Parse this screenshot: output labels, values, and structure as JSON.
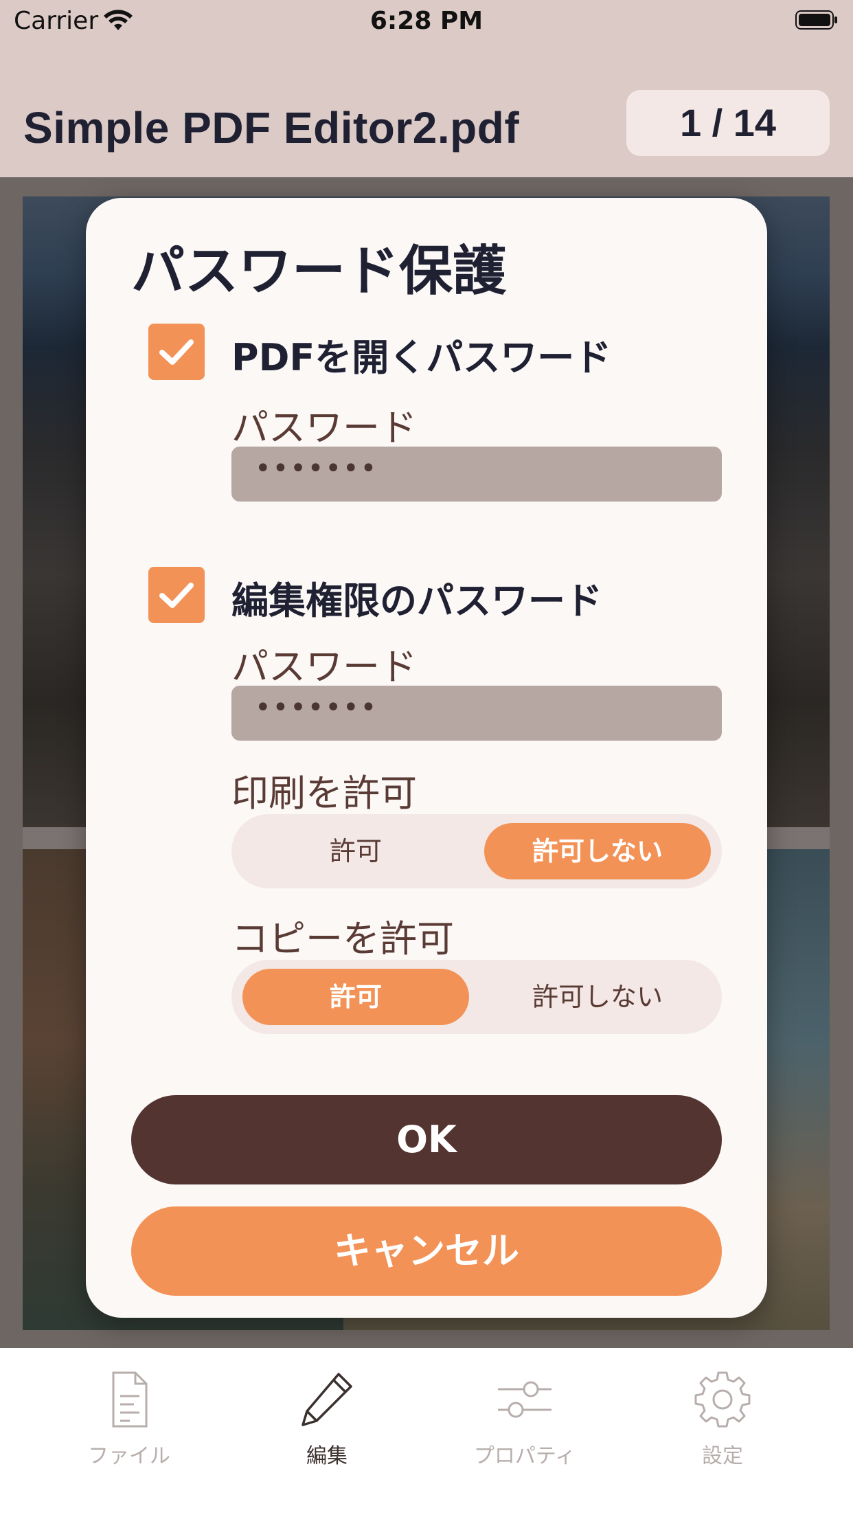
{
  "status_bar": {
    "carrier": "Carrier",
    "time": "6:28 PM"
  },
  "header": {
    "title": "Simple PDF Editor2.pdf",
    "page_counter": "1 / 14"
  },
  "dialog": {
    "title": "パスワード保護",
    "open_password": {
      "checked": true,
      "label": "PDFを開くパスワード",
      "field_label": "パスワード",
      "value": "•••••••"
    },
    "edit_password": {
      "checked": true,
      "label": "編集権限のパスワード",
      "field_label": "パスワード",
      "value": "•••••••"
    },
    "print_permission": {
      "label": "印刷を許可",
      "options": [
        "許可",
        "許可しない"
      ],
      "selected": "許可しない"
    },
    "copy_permission": {
      "label": "コピーを許可",
      "options": [
        "許可",
        "許可しない"
      ],
      "selected": "許可"
    },
    "ok_label": "OK",
    "cancel_label": "キャンセル"
  },
  "tab_bar": {
    "items": [
      {
        "label": "ファイル",
        "icon": "document-icon",
        "active": false
      },
      {
        "label": "編集",
        "icon": "pencil-icon",
        "active": true
      },
      {
        "label": "プロパティ",
        "icon": "sliders-icon",
        "active": false
      },
      {
        "label": "設定",
        "icon": "gear-icon",
        "active": false
      }
    ]
  },
  "colors": {
    "accent": "#f39256",
    "dark_brown": "#533430",
    "header_bg": "#dccac6",
    "field_bg": "#b6a7a3"
  }
}
